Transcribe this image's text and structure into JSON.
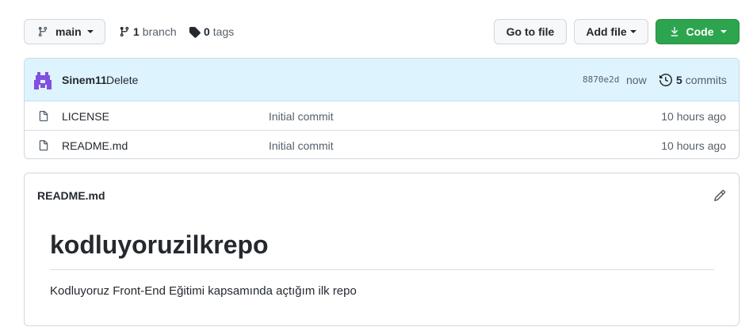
{
  "toolbar": {
    "branch_button": "main",
    "branch_count": "1",
    "branch_word": "branch",
    "tag_count": "0",
    "tag_word": "tags",
    "go_to_file": "Go to file",
    "add_file": "Add file",
    "code": "Code"
  },
  "latest_commit": {
    "author": "Sinem11",
    "message": "Delete",
    "sha": "8870e2d",
    "time": "now",
    "commit_count": "5",
    "commit_word": "commits"
  },
  "files": [
    {
      "icon": "file-icon",
      "name": "LICENSE",
      "message": "Initial commit",
      "age": "10 hours ago"
    },
    {
      "icon": "file-icon",
      "name": "README.md",
      "message": "Initial commit",
      "age": "10 hours ago"
    }
  ],
  "readme": {
    "filename": "README.md",
    "heading": "kodluyoruzilkrepo",
    "paragraph": "Kodluyoruz Front-End Eğitimi kapsamında açtığım ilk repo"
  },
  "colors": {
    "code_button": "#2da44e",
    "commit_bar": "#ddf4ff",
    "avatar": "#8250df"
  }
}
